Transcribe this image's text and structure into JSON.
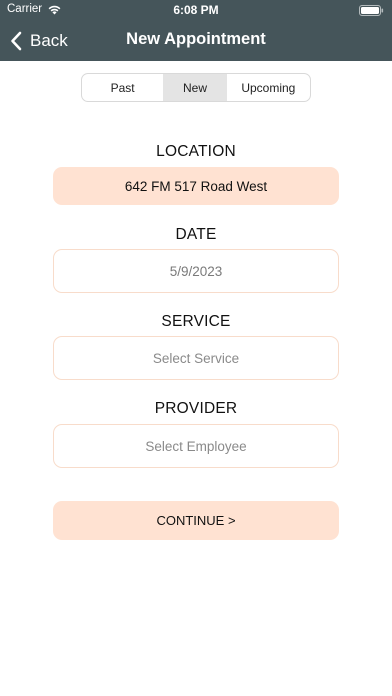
{
  "status_bar": {
    "carrier": "Carrier",
    "time": "6:08 PM",
    "wifi_icon": "wifi-icon",
    "battery_icon": "battery-icon"
  },
  "nav": {
    "back_label": "Back",
    "back_icon": "chevron-left-icon",
    "title": "New Appointment"
  },
  "segments": [
    {
      "label": "Past",
      "selected": false
    },
    {
      "label": "New",
      "selected": true
    },
    {
      "label": "Upcoming",
      "selected": false
    }
  ],
  "form": {
    "location": {
      "label": "LOCATION",
      "value": "642 FM 517 Road West"
    },
    "date": {
      "label": "DATE",
      "value": "5/9/2023"
    },
    "service": {
      "label": "SERVICE",
      "placeholder": "Select Service"
    },
    "provider": {
      "label": "PROVIDER",
      "placeholder": "Select Employee"
    }
  },
  "continue_label": "CONTINUE >",
  "colors": {
    "header_bg": "#45555a",
    "accent_fill": "#ffe2d2",
    "accent_border": "#f8dccb",
    "segment_selected": "#e4e4e4"
  }
}
